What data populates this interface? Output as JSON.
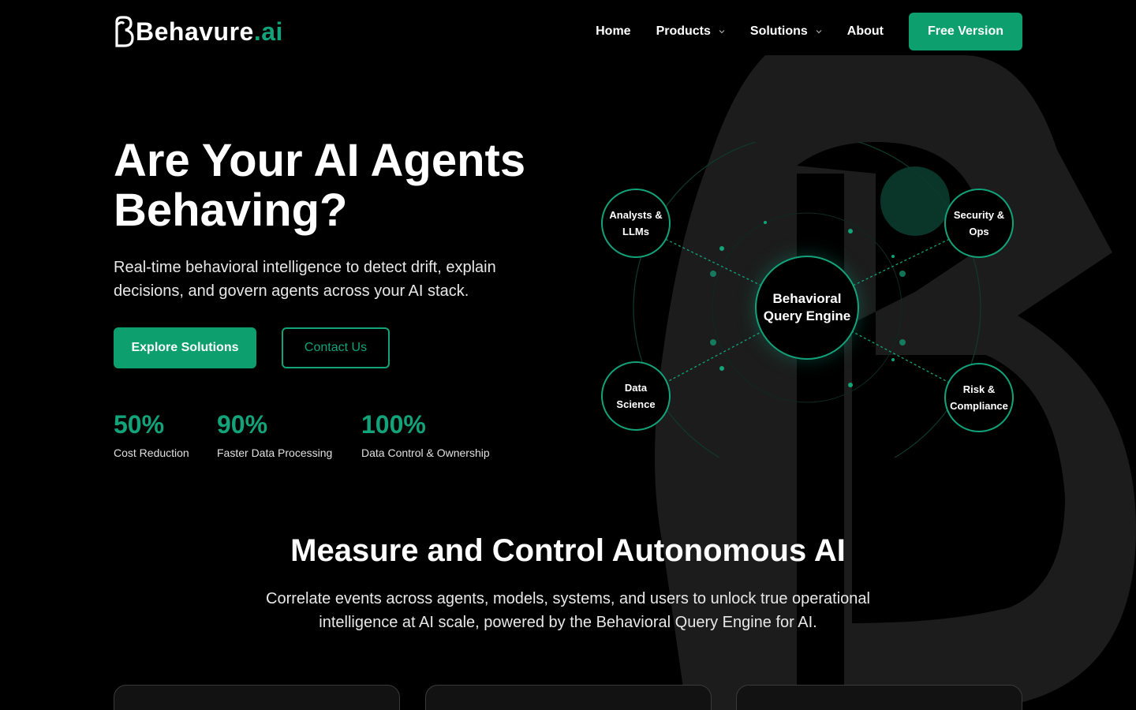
{
  "header": {
    "logo": {
      "text": "Behavure",
      "suffix": ".ai"
    },
    "nav": [
      {
        "label": "Home",
        "has_dropdown": false
      },
      {
        "label": "Products",
        "has_dropdown": true
      },
      {
        "label": "Solutions",
        "has_dropdown": true
      },
      {
        "label": "About",
        "has_dropdown": false
      }
    ],
    "cta_label": "Free Version"
  },
  "hero": {
    "title": "Are Your AI Agents Behaving?",
    "subtitle": "Real-time behavioral intelligence to detect drift, explain decisions, and govern agents across your AI stack.",
    "primary_button": "Explore Solutions",
    "secondary_button": "Contact Us",
    "stats": [
      {
        "value": "50%",
        "label": "Cost Reduction"
      },
      {
        "value": "90%",
        "label": "Faster Data Processing"
      },
      {
        "value": "100%",
        "label": "Data Control & Ownership"
      }
    ]
  },
  "diagram": {
    "center": [
      "Behavioral",
      "Query Engine"
    ],
    "nodes": [
      {
        "lines": [
          "Analysts &",
          "LLMs"
        ]
      },
      {
        "lines": [
          "Security &",
          "Ops"
        ]
      },
      {
        "lines": [
          "Data",
          "Science"
        ]
      },
      {
        "lines": [
          "Risk &",
          "Compliance"
        ]
      }
    ]
  },
  "section": {
    "title": "Measure and Control Autonomous AI",
    "subtitle": "Correlate events across agents, models, systems, and users to unlock true operational intelligence at AI scale, powered by the Behavioral Query Engine for AI."
  },
  "colors": {
    "accent": "#0e9f6e",
    "accent_text": "#12a37a",
    "background": "#000000",
    "watermark": "#1c1c1c"
  }
}
